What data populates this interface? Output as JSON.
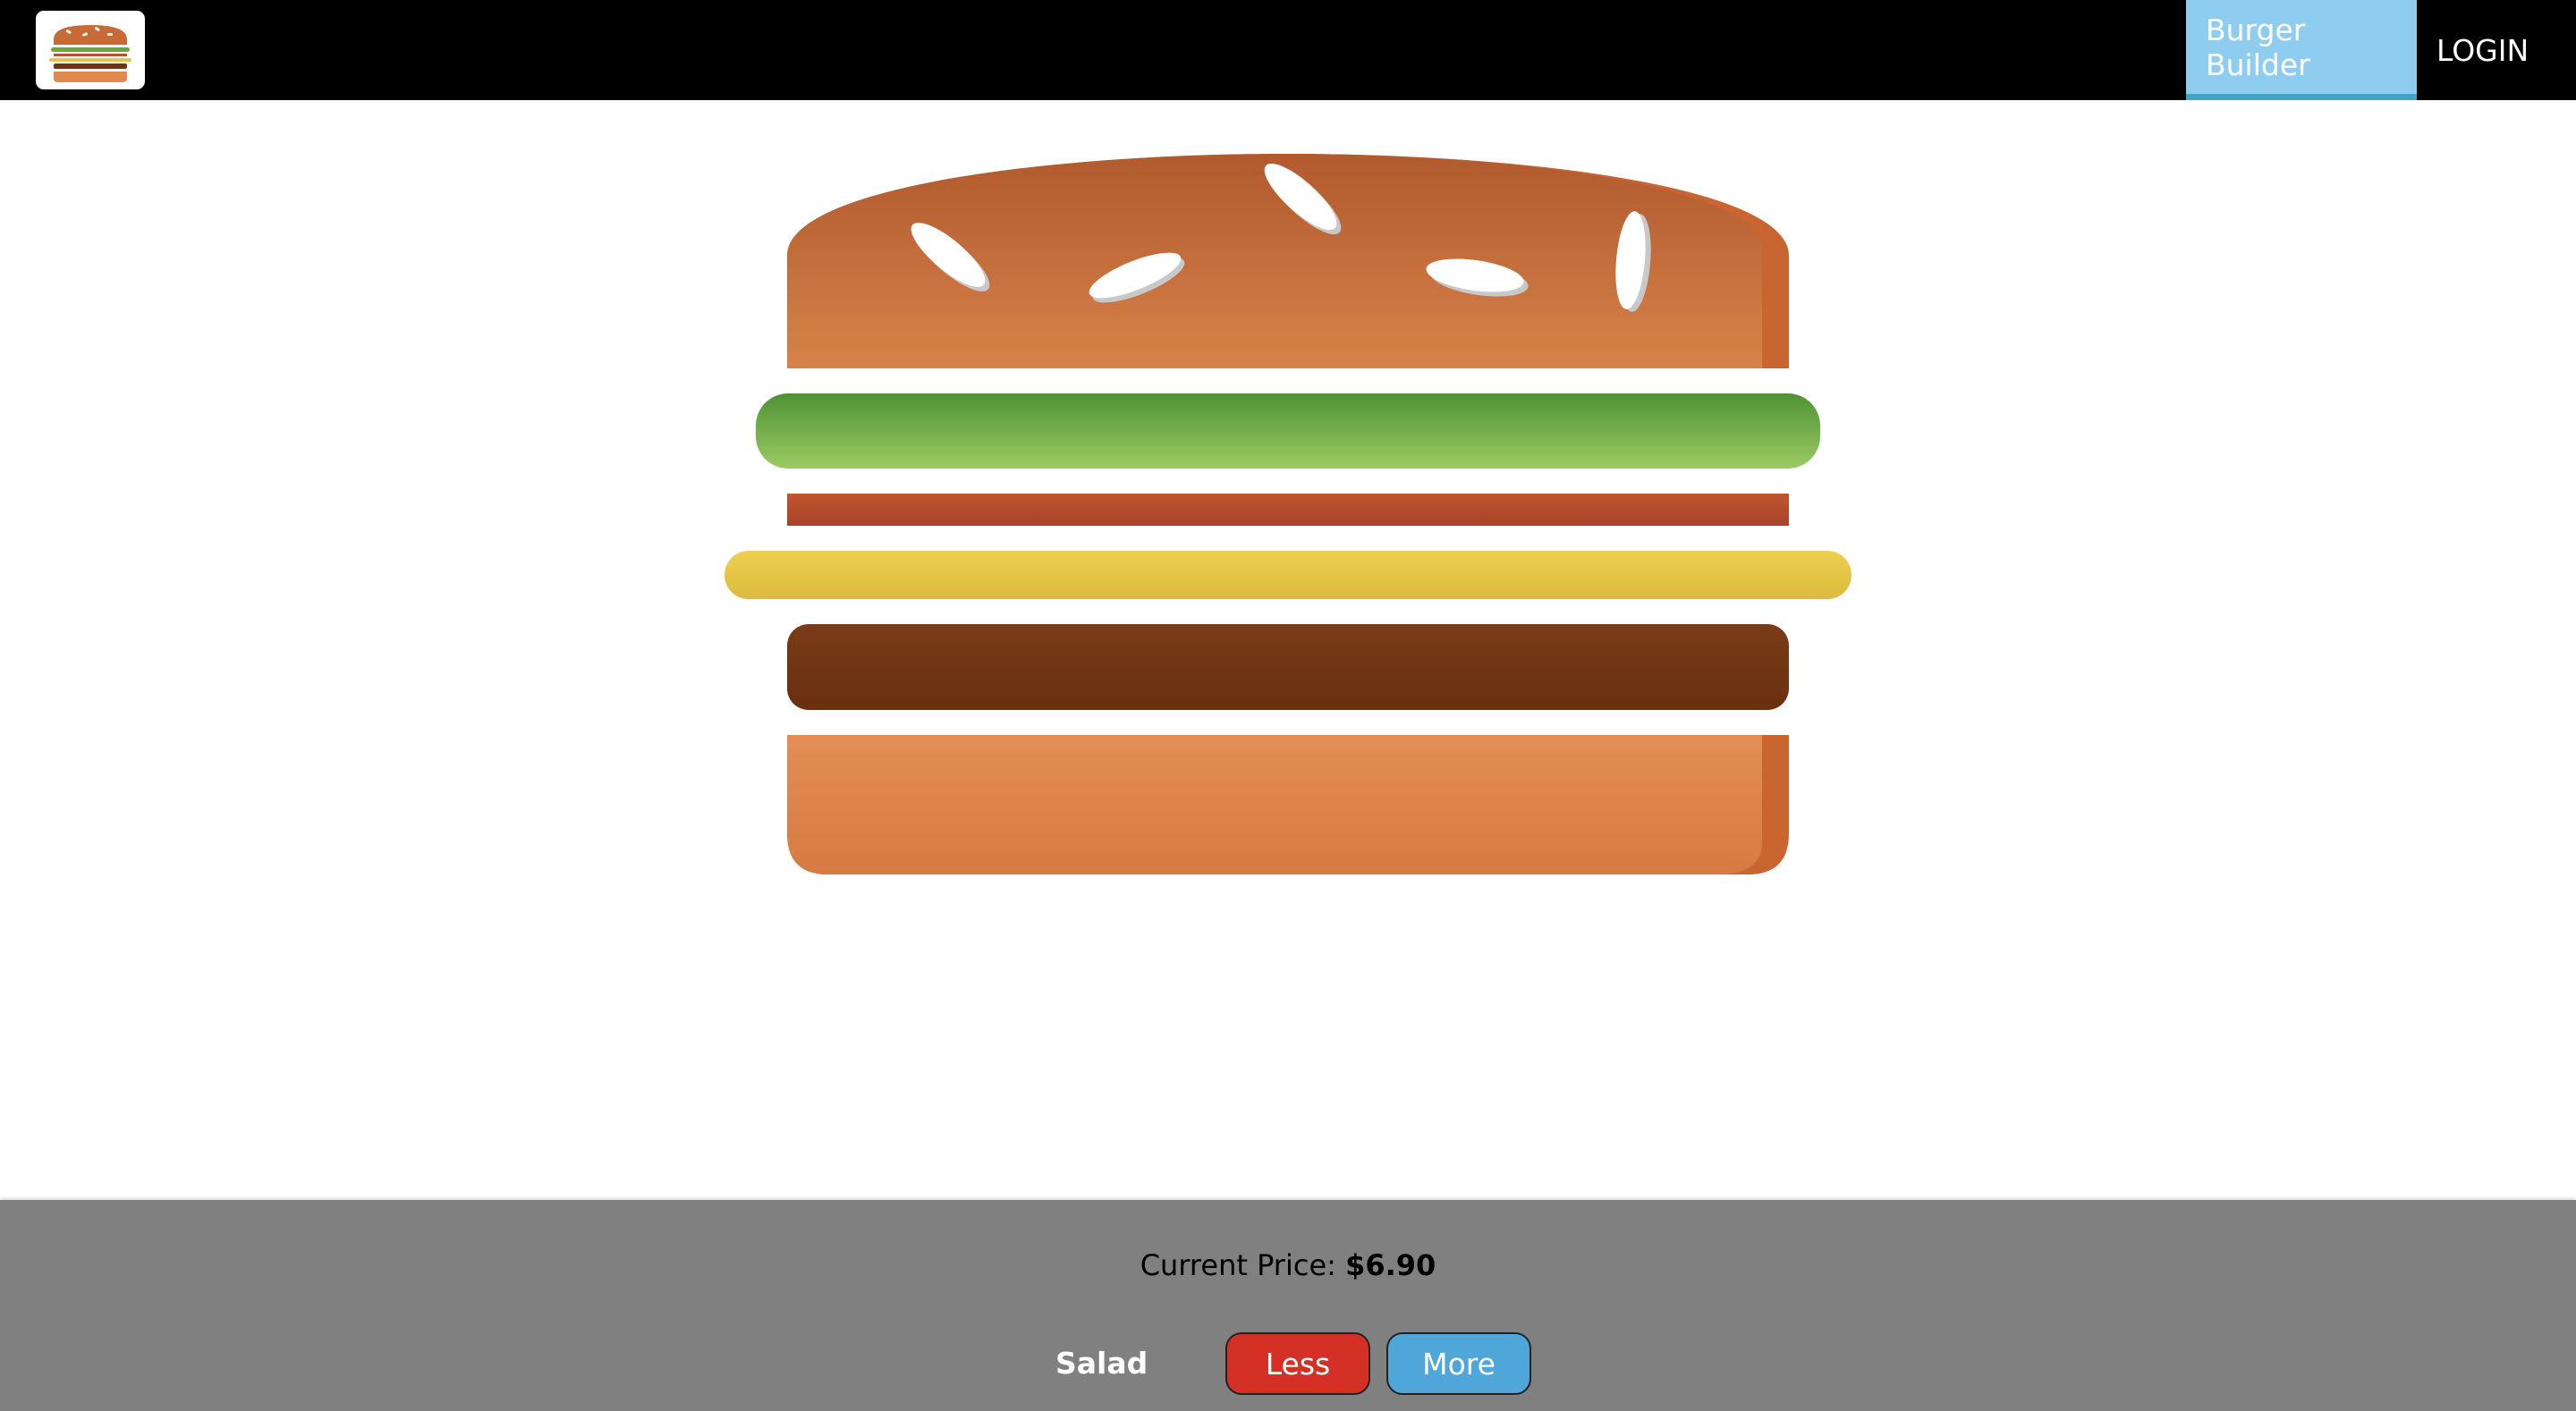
{
  "toolbar": {
    "nav": {
      "burger_builder": "Burger Builder",
      "login": "LOGIN"
    }
  },
  "burger": {
    "layers": [
      "bread-top",
      "salad",
      "bacon",
      "cheese",
      "meat",
      "bread-bottom"
    ]
  },
  "build_controls": {
    "price_label": "Current Price:",
    "price_value": "$6.90",
    "controls": [
      {
        "label": "Salad",
        "less_label": "Less",
        "more_label": "More"
      }
    ]
  },
  "colors": {
    "toolbar_bg": "#000000",
    "nav_active_bg": "#8fcdf0",
    "nav_active_border": "#40a4c8",
    "controls_bg": "#808080",
    "less_button": "#d53026",
    "more_button": "#4fa6d8",
    "bun": "#d3783d",
    "salad": "#6aa83a",
    "bacon": "#b8502e",
    "cheese": "#e6c64a",
    "meat": "#6e3515"
  }
}
